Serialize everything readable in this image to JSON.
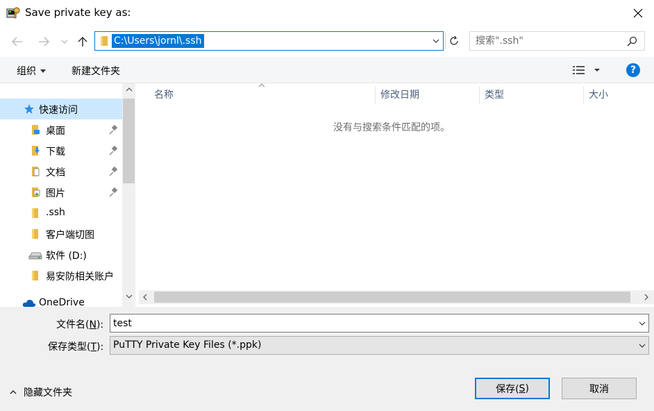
{
  "window": {
    "title": "Save private key as:"
  },
  "nav": {
    "address": "C:\\Users\\jornl\\.ssh",
    "search_placeholder": "搜索\".ssh\""
  },
  "toolbar": {
    "organize_label": "组织",
    "new_folder_label": "新建文件夹"
  },
  "sidebar": {
    "items": [
      {
        "label": "快速访问",
        "icon": "star-icon",
        "pinned": false,
        "selected": true
      },
      {
        "label": "桌面",
        "icon": "desktop-folder-icon",
        "pinned": true
      },
      {
        "label": "下载",
        "icon": "download-folder-icon",
        "pinned": true
      },
      {
        "label": "文档",
        "icon": "documents-folder-icon",
        "pinned": true
      },
      {
        "label": "图片",
        "icon": "pictures-folder-icon",
        "pinned": true
      },
      {
        "label": ".ssh",
        "icon": "folder-icon",
        "pinned": false
      },
      {
        "label": "客户端切图",
        "icon": "folder-icon",
        "pinned": false
      },
      {
        "label": "软件 (D:)",
        "icon": "drive-icon",
        "pinned": false
      },
      {
        "label": "易安防相关账户",
        "icon": "folder-icon",
        "pinned": false
      },
      {
        "label": "OneDrive",
        "icon": "cloud-icon",
        "pinned": false
      }
    ]
  },
  "filelist": {
    "columns": [
      "名称",
      "修改日期",
      "类型",
      "大小"
    ],
    "empty_message": "没有与搜索条件匹配的项。"
  },
  "form": {
    "filename_label_prefix": "文件名(",
    "filename_label_key": "N",
    "filename_label_suffix": "):",
    "filename_value": "test",
    "filetype_label_prefix": "保存类型(",
    "filetype_label_key": "T",
    "filetype_label_suffix": "):",
    "filetype_value": "PuTTY Private Key Files (*.ppk)"
  },
  "footer": {
    "hide_folders_label": "隐藏文件夹",
    "save_label_prefix": "保存(",
    "save_label_key": "S",
    "save_label_suffix": ")",
    "cancel_label": "取消"
  },
  "colors": {
    "accent": "#0078d7",
    "selected_bg": "#cce8ff",
    "folder": "#e8b84a"
  }
}
